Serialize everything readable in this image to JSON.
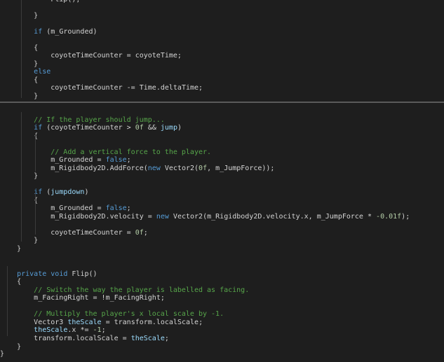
{
  "editor": {
    "lines": [
      "            Flip();",
      "        }",
      "",
      "        if (m_Grounded)",
      "        {",
      "            coyoteTimeCounter = coyoteTime;",
      "        }",
      "        else",
      "        {",
      "            coyoteTimeCounter -= Time.deltaTime;",
      "        }",
      "",
      "",
      "        // If the player should jump...",
      "        if (coyoteTimeCounter > 0f && jump)",
      "        {",
      "",
      "            // Add a vertical force to the player.",
      "            m_Grounded = false;",
      "            m_Rigidbody2D.AddForce(new Vector2(0f, m_JumpForce));",
      "        }",
      "",
      "        if (jumpdown)",
      "        {",
      "            m_Grounded = false;",
      "            m_Rigidbody2D.velocity = new Vector2(m_Rigidbody2D.velocity.x, m_JumpForce * -0.01f);",
      "",
      "            coyoteTimeCounter = 0f;",
      "        }",
      "    }",
      "",
      "",
      "    private void Flip()",
      "    {",
      "        // Switch the way the player is labelled as facing.",
      "        m_FacingRight = !m_FacingRight;",
      "",
      "        // Multiply the player's x local scale by -1.",
      "        Vector3 theScale = transform.localScale;",
      "        theScale.x *= -1;",
      "        transform.localScale = theScale;",
      "    }",
      "}"
    ]
  },
  "colors": {
    "background": "#1e1e1e",
    "keyword": "#569cd6",
    "comment": "#57a64a",
    "number": "#b5cea8",
    "text": "#d4d4d4",
    "identifier": "#9cdcfe"
  }
}
